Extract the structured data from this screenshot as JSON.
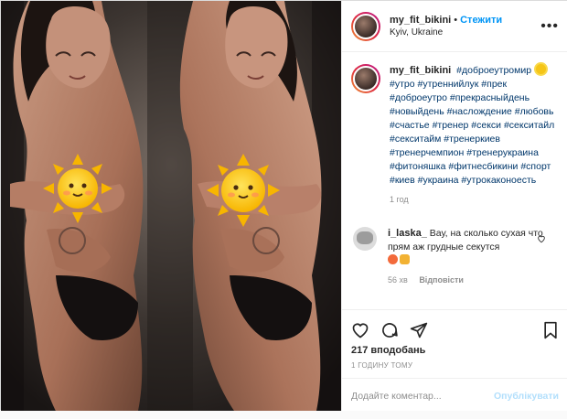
{
  "post": {
    "username": "my_fit_bikini",
    "follow_label": "Стежити",
    "separator": "•",
    "location": "Kyiv, Ukraine"
  },
  "caption": {
    "username": "my_fit_bikini",
    "text": "#доброеутромир",
    "tags": "#утро #утреннийлук #прек #доброеутро #прекрасныйдень #новыйдень #наслождение #любовь #счастье #тренер #секси #секситайл #секситайм #тренеркиев #тренерчемпион #тренерукраина #фитоняшка #фитнесбикини #спорт #киев #украина #утрокаконоесть",
    "age": "1 год"
  },
  "comment": {
    "username": "i_laska_",
    "text": "Вау, на сколько сухая что прям аж грудные секутся",
    "age": "56 хв",
    "reply_label": "Відповісти"
  },
  "actions": {
    "likes": "217 вподобань",
    "time": "1 годину тому",
    "comment_placeholder": "Додайте коментар...",
    "publish_label": "Опублікувати"
  },
  "icons": {
    "more": "more-options-icon",
    "like": "heart-icon",
    "comment": "comment-bubble-icon",
    "share": "paper-plane-icon",
    "save": "bookmark-icon",
    "sticker": "sun-sticker-icon"
  },
  "colors": {
    "link": "#0095f6",
    "hashtag": "#00376b",
    "muted": "#8e8e8e",
    "publish_disabled": "#b2dffc"
  }
}
